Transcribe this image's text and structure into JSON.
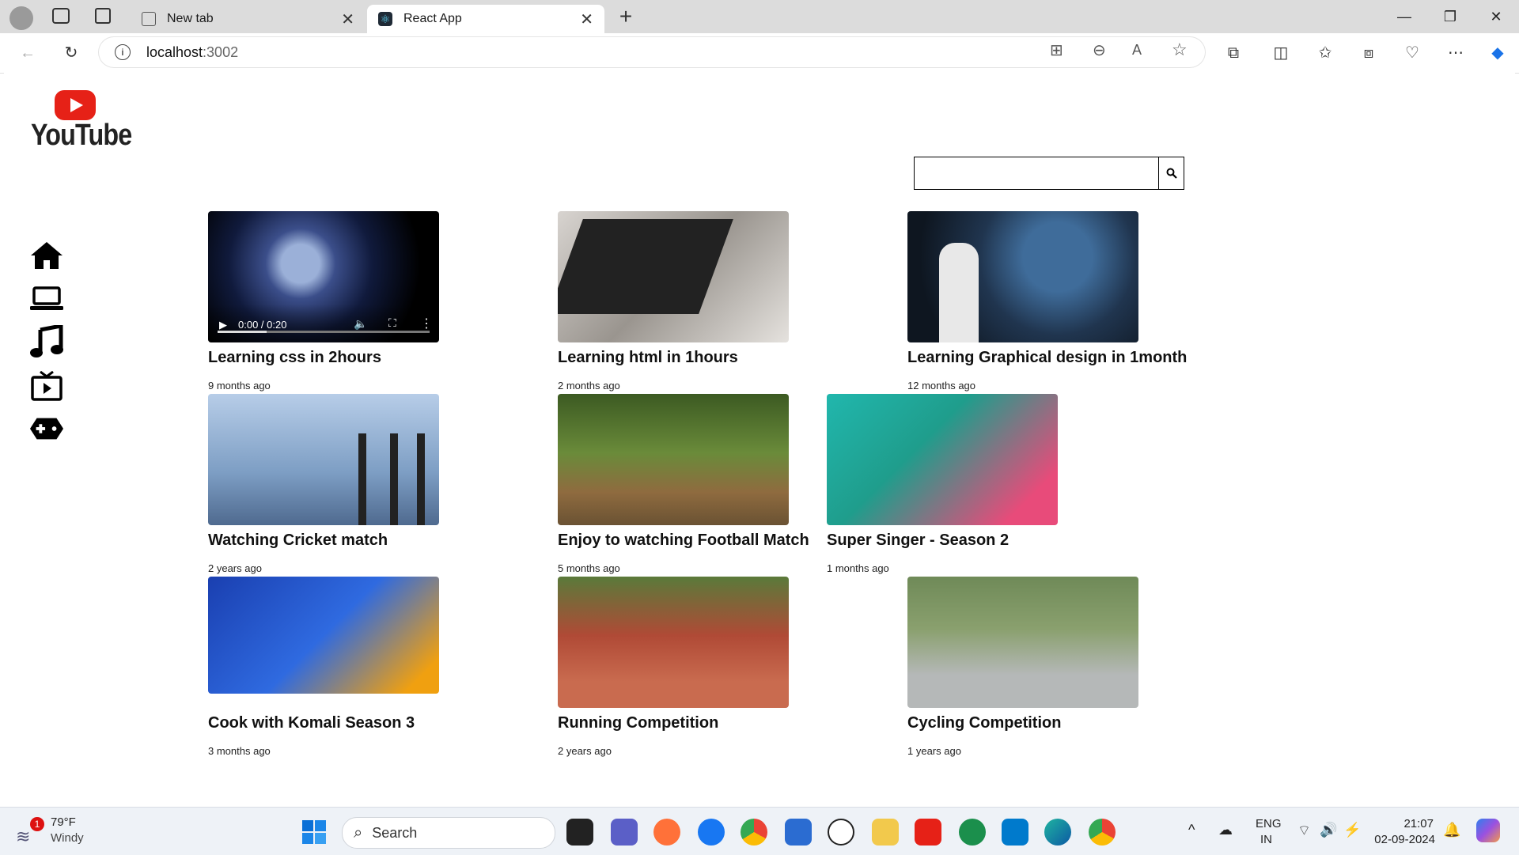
{
  "browser": {
    "tabs": [
      {
        "title": "New tab",
        "active": false
      },
      {
        "title": "React App",
        "active": true
      }
    ],
    "url_host": "localhost",
    "url_port": ":3002"
  },
  "app": {
    "logo_text": "YouTube",
    "search_placeholder": "",
    "sidebar": [
      "home-icon",
      "laptop-icon",
      "music-icon",
      "tv-icon",
      "gamepad-icon"
    ],
    "video_time": "0:00 / 0:20",
    "videos": [
      {
        "title": "Learning css in 2hours",
        "time": "9 months ago",
        "thumb": "news"
      },
      {
        "title": "Learning html in 1hours",
        "time": "2 months ago",
        "thumb": "code"
      },
      {
        "title": "Learning Graphical design in 1month",
        "time": "12 months ago",
        "thumb": "design"
      },
      {
        "title": "Watching Cricket match",
        "time": "2 years ago",
        "thumb": "cricket"
      },
      {
        "title": "Enjoy to watching Football Match",
        "time": "5 months ago",
        "thumb": "football"
      },
      {
        "title": "Super Singer - Season 2",
        "time": "1 months ago",
        "thumb": "singer"
      },
      {
        "title": "Cook with Komali Season 3",
        "time": "3 months ago",
        "thumb": "cook"
      },
      {
        "title": "Running Competition",
        "time": "2 years ago",
        "thumb": "run"
      },
      {
        "title": "Cycling Competition",
        "time": "1 years ago",
        "thumb": "cycle"
      }
    ]
  },
  "taskbar": {
    "weather_temp": "79°F",
    "weather_desc": "Windy",
    "weather_badge": "1",
    "search_label": "Search",
    "lang_top": "ENG",
    "lang_bottom": "IN",
    "time": "21:07",
    "date": "02-09-2024"
  }
}
